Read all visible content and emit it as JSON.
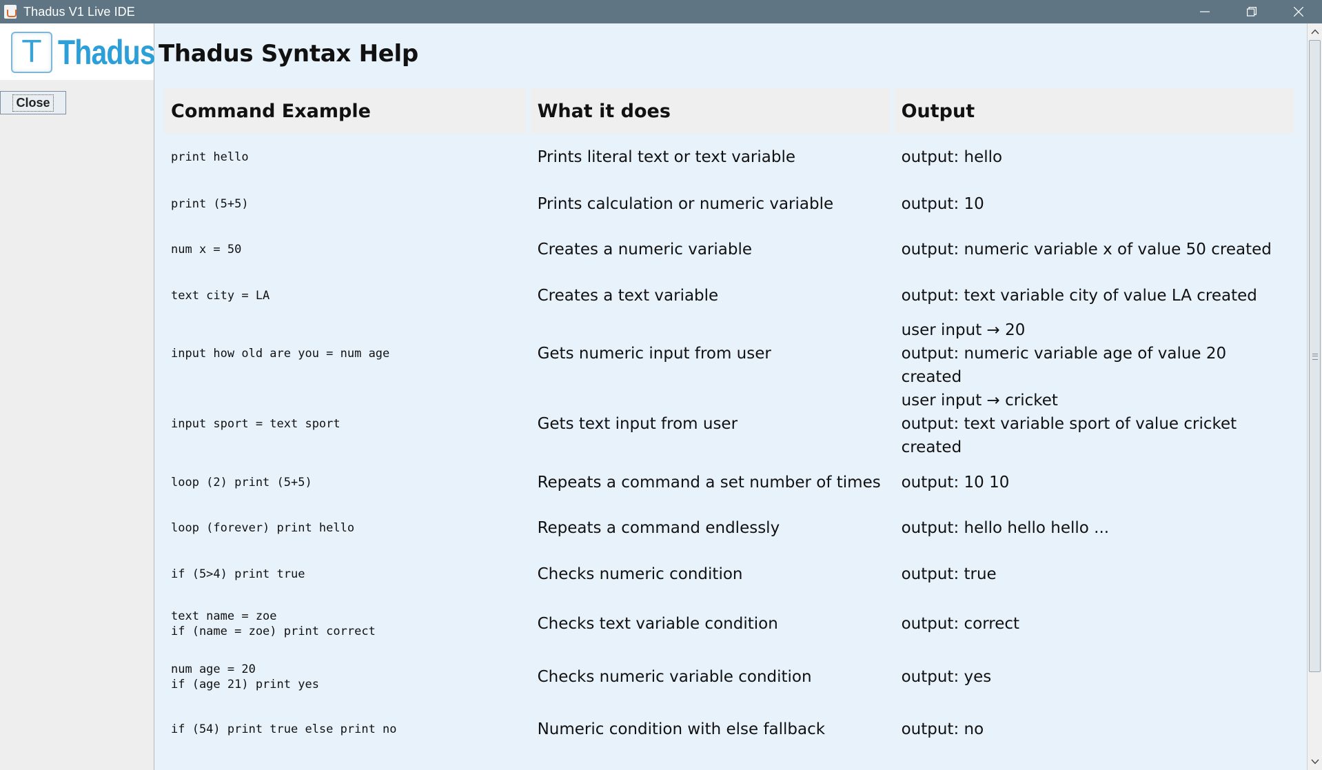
{
  "window": {
    "title": "Thadus V1 Live IDE",
    "minimize_icon": "minimize-icon",
    "maximize_icon": "restore-icon",
    "close_icon": "close-icon"
  },
  "sidebar": {
    "logo_letter": "T",
    "logo_text": "Thadus",
    "close_label": "Close"
  },
  "main": {
    "title": "Thadus Syntax Help",
    "columns": [
      "Command Example",
      "What it does",
      "Output"
    ],
    "rows": [
      {
        "cmd": [
          "print hello"
        ],
        "desc": "Prints literal text or text variable",
        "out": [
          "output: hello"
        ]
      },
      {
        "cmd": [
          "print (5+5)"
        ],
        "desc": "Prints calculation or numeric variable",
        "out": [
          "output: 10"
        ]
      },
      {
        "cmd": [
          "num x = 50"
        ],
        "desc": "Creates a numeric variable",
        "out": [
          "output: numeric variable x of value 50 created"
        ]
      },
      {
        "cmd": [
          "text city = LA"
        ],
        "desc": "Creates a text variable",
        "out": [
          "output: text variable city of value LA created"
        ]
      },
      {
        "cmd": [
          "input how old are you = num age"
        ],
        "desc": "Gets numeric input from user",
        "out": [
          "user input → 20",
          "output: numeric variable age of value 20 created"
        ]
      },
      {
        "cmd": [
          "input sport = text sport"
        ],
        "desc": "Gets text input from user",
        "out": [
          "user input → cricket",
          "output: text variable sport of value cricket created"
        ]
      },
      {
        "cmd": [
          "loop (2) print (5+5)"
        ],
        "desc": "Repeats a command a set number of times",
        "out": [
          "output: 10 10"
        ]
      },
      {
        "cmd": [
          "loop (forever) print hello"
        ],
        "desc": "Repeats a command endlessly",
        "out": [
          "output: hello hello hello ..."
        ]
      },
      {
        "cmd": [
          "if (5>4) print true"
        ],
        "desc": "Checks numeric condition",
        "out": [
          "output: true"
        ]
      },
      {
        "cmd": [
          "text name = zoe",
          "if (name = zoe) print correct"
        ],
        "desc": "Checks text variable condition",
        "out": [
          "output: correct"
        ]
      },
      {
        "cmd": [
          "num age = 20",
          "if (age 21) print yes"
        ],
        "desc": "Checks numeric variable condition",
        "out": [
          "output: yes"
        ]
      },
      {
        "cmd": [
          "if (54) print true else print no"
        ],
        "desc": "Numeric condition with else fallback",
        "out": [
          "output: no"
        ]
      }
    ]
  },
  "colors": {
    "titlebar": "#5f7584",
    "content_bg": "#e8f2fb",
    "header_bg": "#efefef",
    "logo_blue": "#2d9fd8"
  }
}
